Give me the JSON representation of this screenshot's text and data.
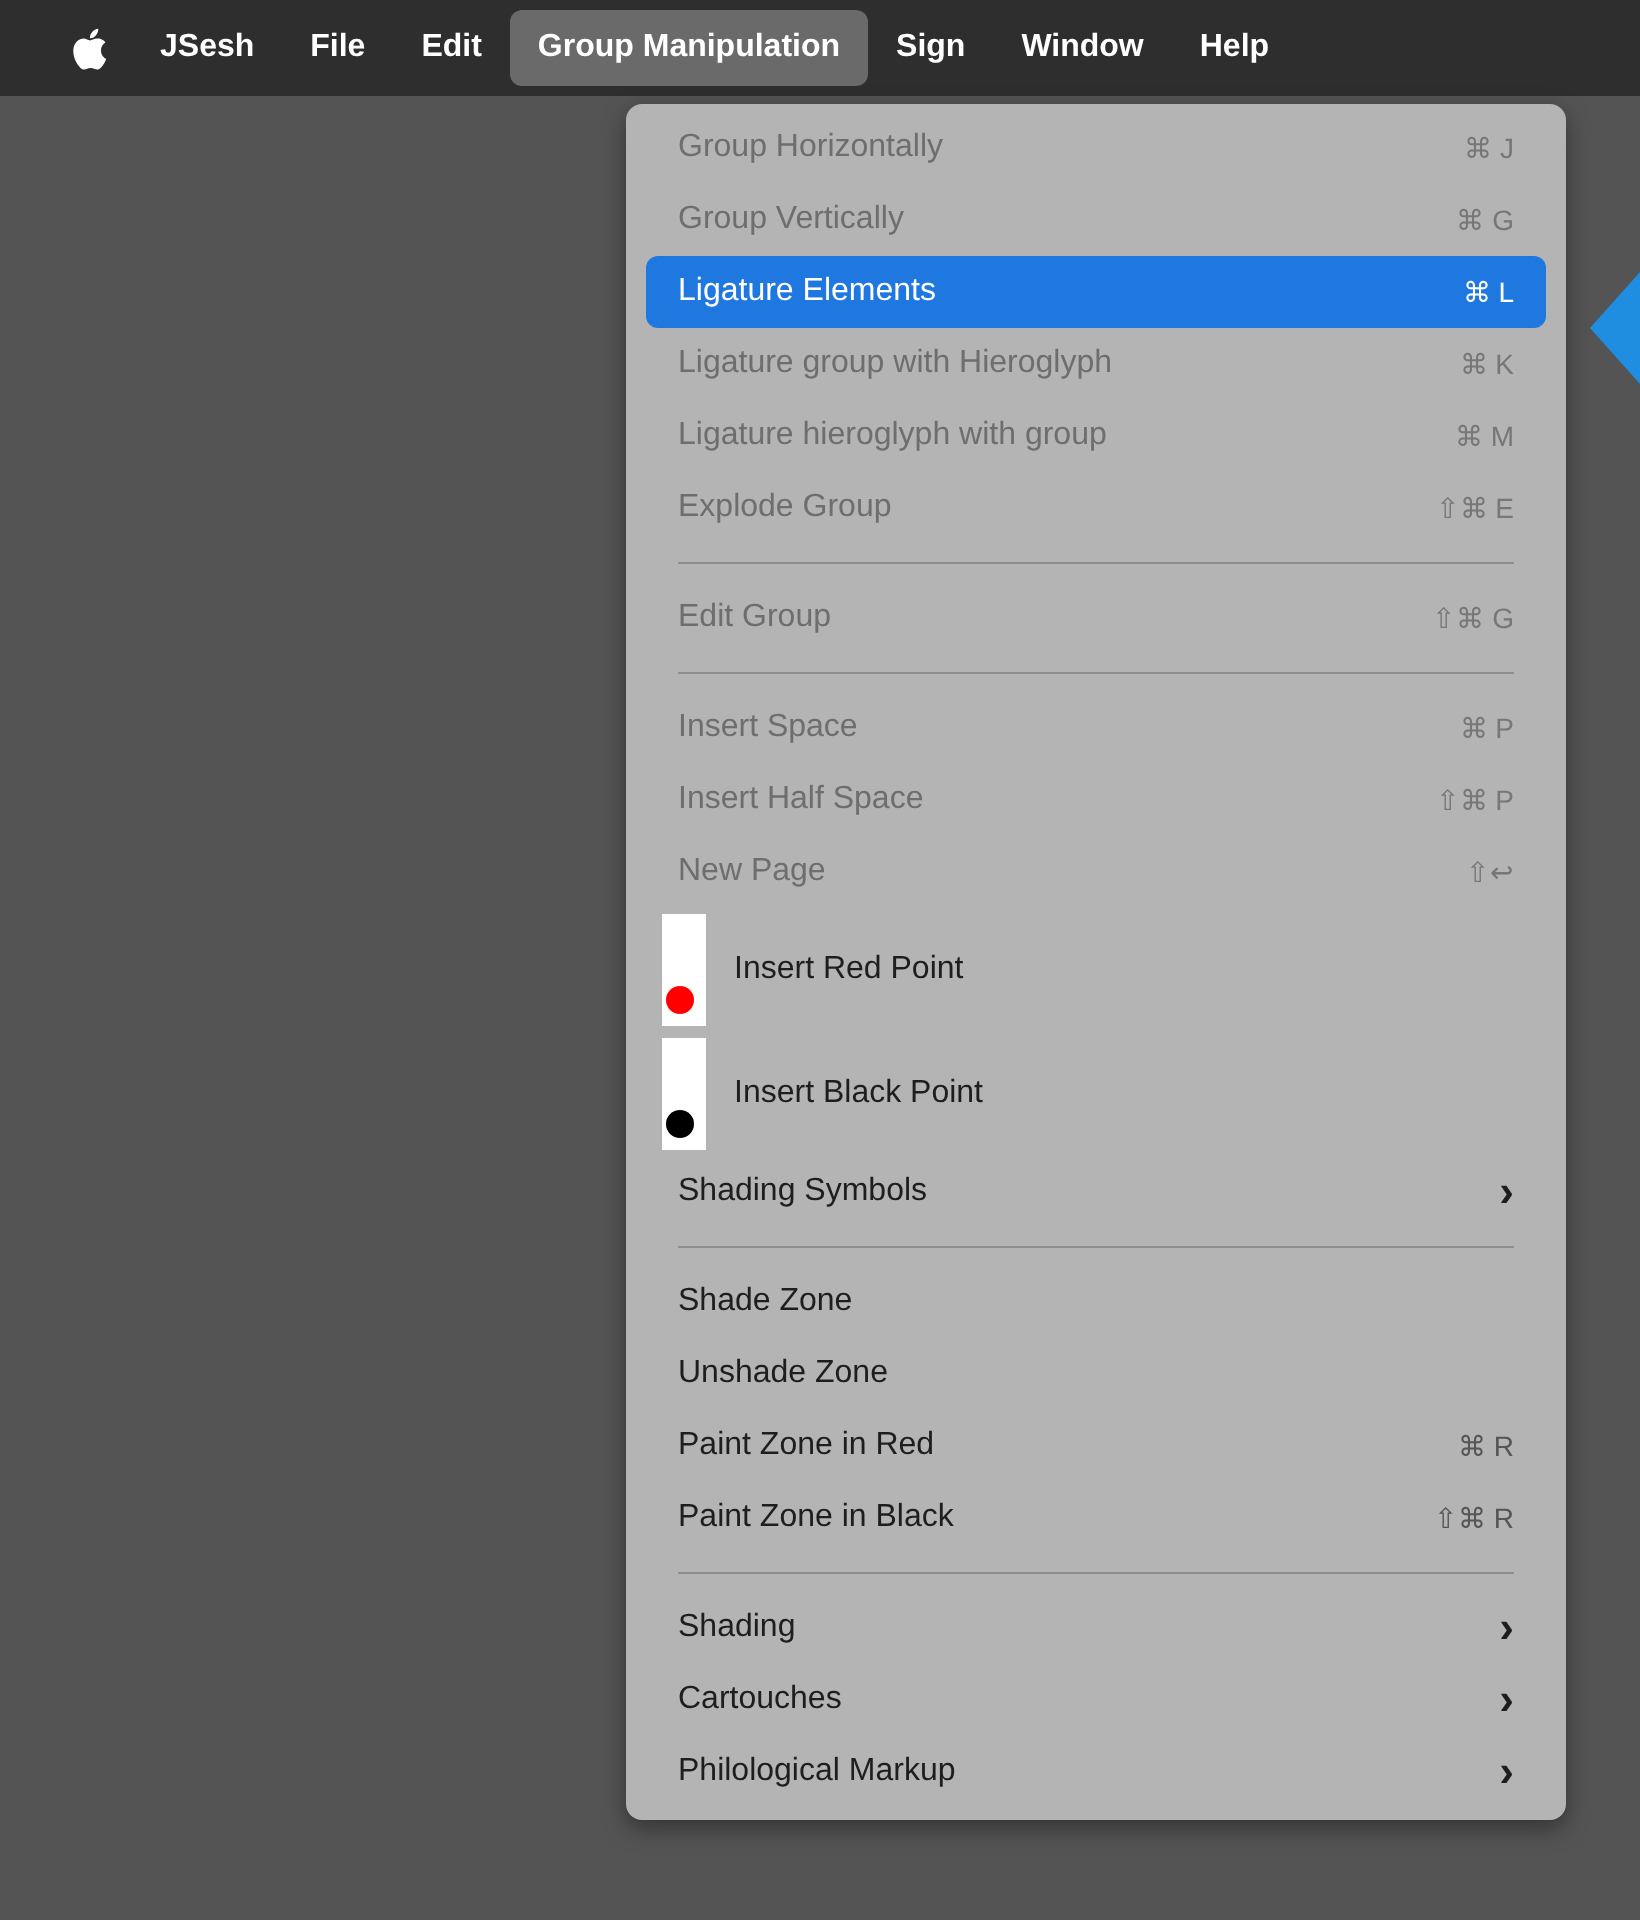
{
  "menubar": [
    {
      "label": "JSesh",
      "selected": false
    },
    {
      "label": "File",
      "selected": false
    },
    {
      "label": "Edit",
      "selected": false
    },
    {
      "label": "Group Manipulation",
      "selected": true
    },
    {
      "label": "Sign",
      "selected": false
    },
    {
      "label": "Window",
      "selected": false
    },
    {
      "label": "Help",
      "selected": false
    }
  ],
  "menu": [
    {
      "kind": "command",
      "label": "Group Horizontally",
      "shortcut": "⌘ J",
      "disabled": true,
      "selected": false
    },
    {
      "kind": "command",
      "label": "Group Vertically",
      "shortcut": "⌘ G",
      "disabled": true,
      "selected": false
    },
    {
      "kind": "command",
      "label": "Ligature Elements",
      "shortcut": "⌘ L",
      "disabled": false,
      "selected": true
    },
    {
      "kind": "command",
      "label": "Ligature group with Hieroglyph",
      "shortcut": "⌘ K",
      "disabled": true,
      "selected": false
    },
    {
      "kind": "command",
      "label": "Ligature hieroglyph with group",
      "shortcut": "⌘ M",
      "disabled": true,
      "selected": false
    },
    {
      "kind": "command",
      "label": "Explode Group",
      "shortcut": "⇧⌘ E",
      "disabled": true,
      "selected": false
    },
    {
      "kind": "separator"
    },
    {
      "kind": "command",
      "label": "Edit Group",
      "shortcut": "⇧⌘ G",
      "disabled": true,
      "selected": false
    },
    {
      "kind": "separator"
    },
    {
      "kind": "command",
      "label": "Insert Space",
      "shortcut": "⌘ P",
      "disabled": true,
      "selected": false
    },
    {
      "kind": "command",
      "label": "Insert Half Space",
      "shortcut": "⇧⌘ P",
      "disabled": true,
      "selected": false
    },
    {
      "kind": "command",
      "label": "New Page",
      "shortcut": "⇧↩",
      "disabled": true,
      "selected": false
    },
    {
      "kind": "point",
      "label": "Insert Red Point",
      "color": "#ff0000",
      "disabled": false,
      "selected": false
    },
    {
      "kind": "point",
      "label": "Insert Black Point",
      "color": "#000000",
      "disabled": false,
      "selected": false
    },
    {
      "kind": "submenu",
      "label": "Shading Symbols",
      "arrow": "›",
      "disabled": false,
      "selected": false
    },
    {
      "kind": "separator"
    },
    {
      "kind": "command",
      "label": "Shade Zone",
      "disabled": false,
      "selected": false
    },
    {
      "kind": "command",
      "label": "Unshade Zone",
      "disabled": false,
      "selected": false
    },
    {
      "kind": "command",
      "label": "Paint Zone in Red",
      "shortcut": "⌘ R",
      "disabled": false,
      "selected": false
    },
    {
      "kind": "command",
      "label": "Paint Zone in Black",
      "shortcut": "⇧⌘ R",
      "disabled": false,
      "selected": false
    },
    {
      "kind": "separator"
    },
    {
      "kind": "submenu",
      "label": "Shading",
      "arrow": "›",
      "disabled": false,
      "selected": false
    },
    {
      "kind": "submenu",
      "label": "Cartouches",
      "arrow": "›",
      "disabled": false,
      "selected": false
    },
    {
      "kind": "submenu",
      "label": "Philological Markup",
      "arrow": "›",
      "disabled": false,
      "selected": false
    }
  ]
}
